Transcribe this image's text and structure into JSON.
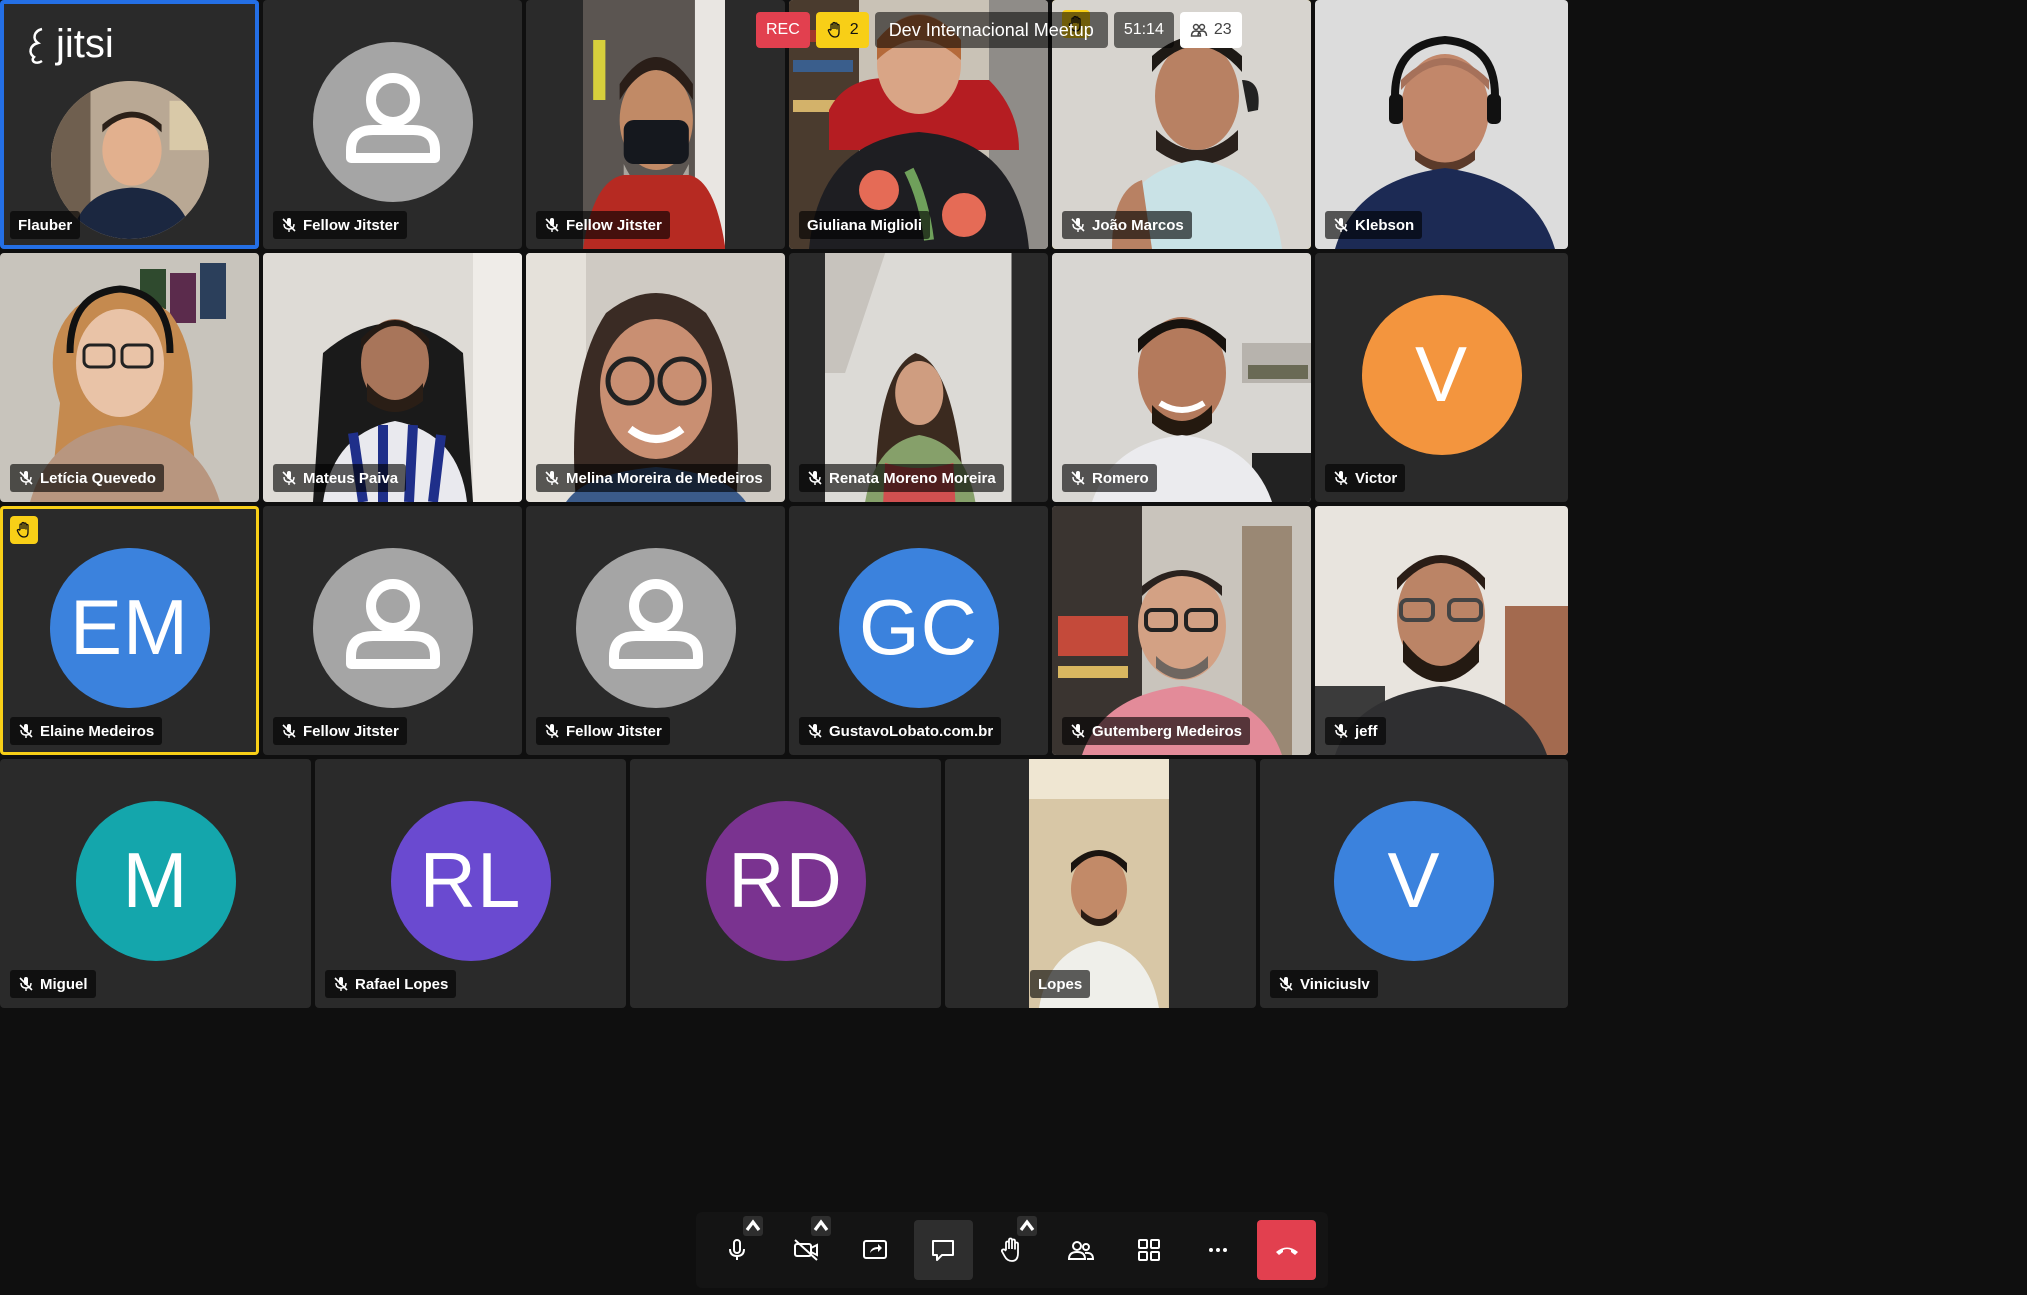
{
  "app": {
    "brand": "jitsi",
    "meeting_title": "Dev Internacional Meetup",
    "recording_label": "REC",
    "raised_hands_count": "2",
    "timer": "51:14",
    "participants_count": "23"
  },
  "colors": {
    "dominant_border": "#246fe5",
    "raised_hand": "#f8cf17",
    "recording": "#e2404f",
    "hangup": "#e2404f",
    "tile_bg": "#2a2a2a"
  },
  "participants": [
    {
      "name": "Flauber",
      "muted": false
    },
    {
      "name": "Fellow Jitster",
      "muted": true
    },
    {
      "name": "Fellow Jitster",
      "muted": true
    },
    {
      "name": "Giuliana Miglioli",
      "muted": false
    },
    {
      "name": "João Marcos",
      "muted": true
    },
    {
      "name": "Klebson",
      "muted": true
    },
    {
      "name": "Letícia Quevedo",
      "muted": true
    },
    {
      "name": "Mateus Paiva",
      "muted": true
    },
    {
      "name": "Melina Moreira de Medeiros",
      "muted": true
    },
    {
      "name": "Renata Moreno Moreira",
      "muted": true
    },
    {
      "name": "Romero",
      "muted": true
    },
    {
      "name": "Victor",
      "muted": true,
      "initials": "V"
    },
    {
      "name": "Elaine Medeiros",
      "muted": true,
      "initials": "EM"
    },
    {
      "name": "Fellow Jitster",
      "muted": true
    },
    {
      "name": "Fellow Jitster",
      "muted": true
    },
    {
      "name": "GustavoLobato.com.br",
      "muted": true,
      "initials": "GC"
    },
    {
      "name": "Gutemberg Medeiros",
      "muted": true
    },
    {
      "name": "jeff",
      "muted": true
    },
    {
      "name": "Miguel",
      "muted": true,
      "initials": "M"
    },
    {
      "name": "Rafael Lopes",
      "muted": true,
      "initials": "RL"
    },
    {
      "name": "",
      "muted": true,
      "initials": "RD"
    },
    {
      "name": "Lopes",
      "muted": true
    },
    {
      "name": "Viniciuslv",
      "muted": true,
      "initials": "V"
    }
  ],
  "toolbar": {
    "items": [
      "microphone-icon",
      "camera-off-icon",
      "share-screen-icon",
      "chat-icon",
      "raise-hand-icon",
      "participants-icon",
      "tile-view-icon",
      "more-icon",
      "hangup-icon"
    ]
  }
}
